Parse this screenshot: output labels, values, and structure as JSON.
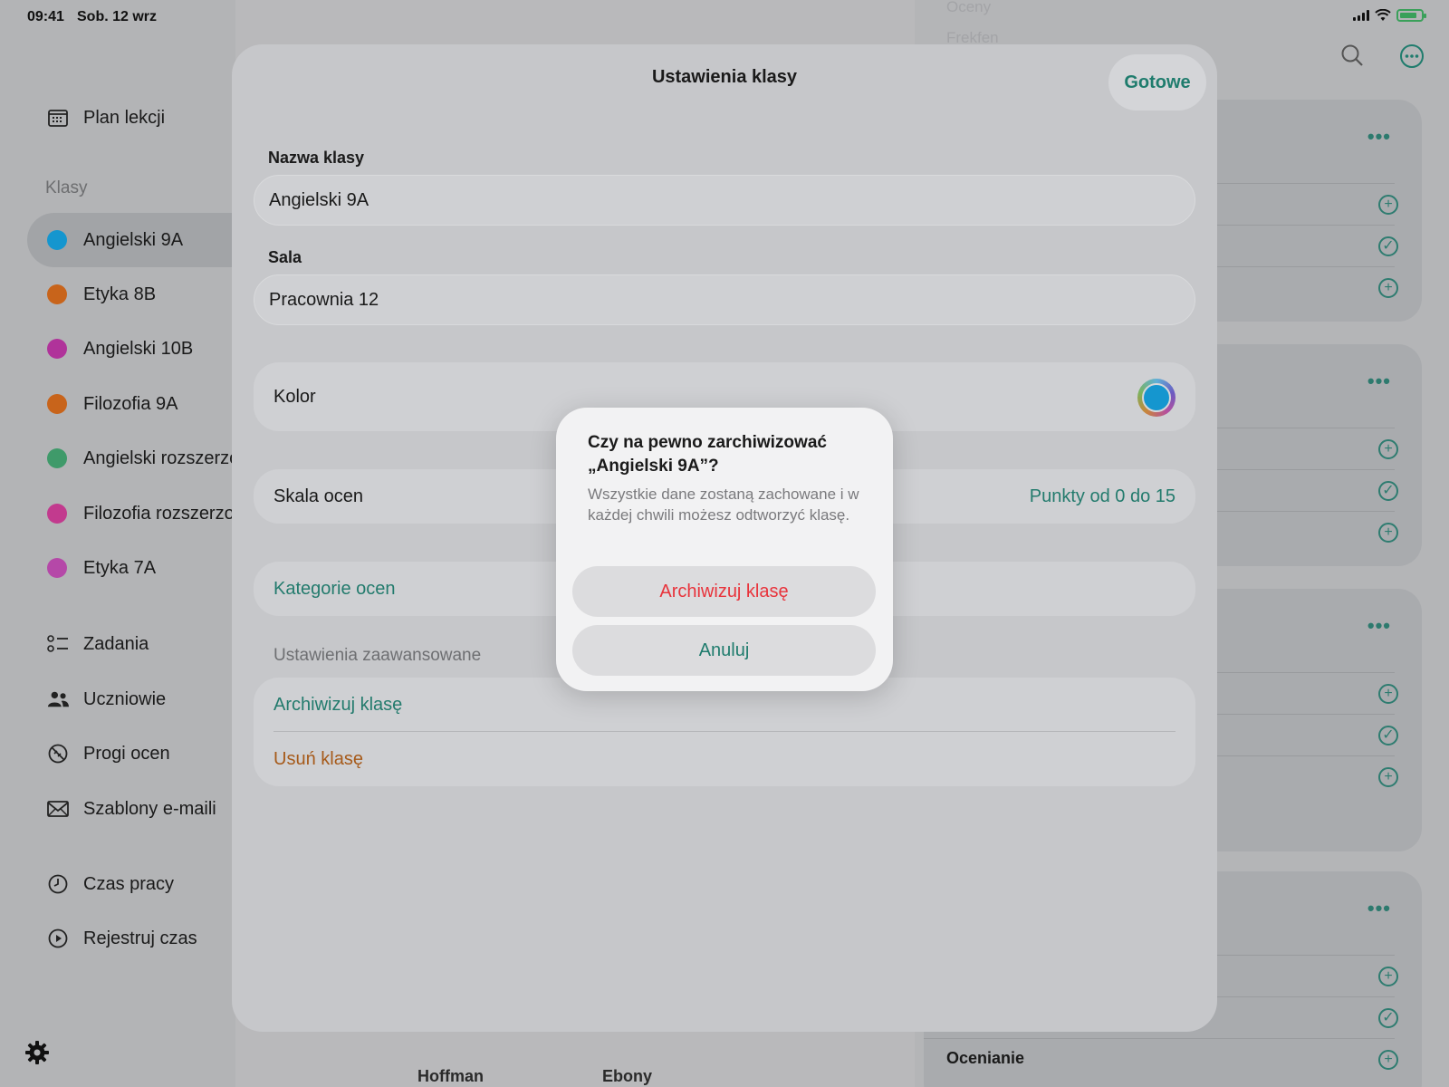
{
  "status_bar": {
    "time": "09:41",
    "date": "Sob. 12 wrz"
  },
  "sidebar": {
    "top_item": "Plan lekcji",
    "section_label": "Klasy",
    "classes": [
      {
        "label": "Angielski 9A",
        "color": "#1596cf"
      },
      {
        "label": "Etyka 8B",
        "color": "#c8641b"
      },
      {
        "label": "Angielski 10B",
        "color": "#b0339a"
      },
      {
        "label": "Filozofia 9A",
        "color": "#c8641b"
      },
      {
        "label": "Angielski rozszerzo",
        "color": "#3f9a6a"
      },
      {
        "label": "Filozofia rozszerzo",
        "color": "#c23a8e"
      },
      {
        "label": "Etyka 7A",
        "color": "#b548a8"
      }
    ],
    "tools": [
      "Zadania",
      "Uczniowie",
      "Progi ocen",
      "Szablony e-maili"
    ],
    "time_items": [
      "Czas pracy",
      "Rejestruj czas"
    ]
  },
  "background": {
    "right_bottom_label": "Ocenianie",
    "bottom_names": [
      "Hoffman",
      "Ebony"
    ],
    "top_faded": [
      "Oceny",
      "Frekfen"
    ]
  },
  "sheet": {
    "title": "Ustawienia klasy",
    "done_label": "Gotowe",
    "name_label": "Nazwa klasy",
    "name_value": "Angielski 9A",
    "room_label": "Sala",
    "room_value": "Pracownia 12",
    "color_label": "Kolor",
    "color_value": "#1596cf",
    "scale_label": "Skala ocen",
    "scale_value": "Punkty od 0 do 15",
    "categories_label": "Kategorie ocen",
    "advanced_label": "Ustawienia zaawansowane",
    "archive_label": "Archiwizuj klasę",
    "delete_label": "Usuń klasę"
  },
  "alert": {
    "title": "Czy na pewno zarchiwizować „Angielski 9A”?",
    "message": "Wszystkie dane zostaną zachowane i w każdej chwili możesz odtworzyć klasę.",
    "confirm_label": "Archiwizuj klasę",
    "cancel_label": "Anuluj"
  },
  "colors": {
    "accent": "#1f7c6d",
    "destructive": "#e8333b",
    "warning": "#a65a1a"
  }
}
